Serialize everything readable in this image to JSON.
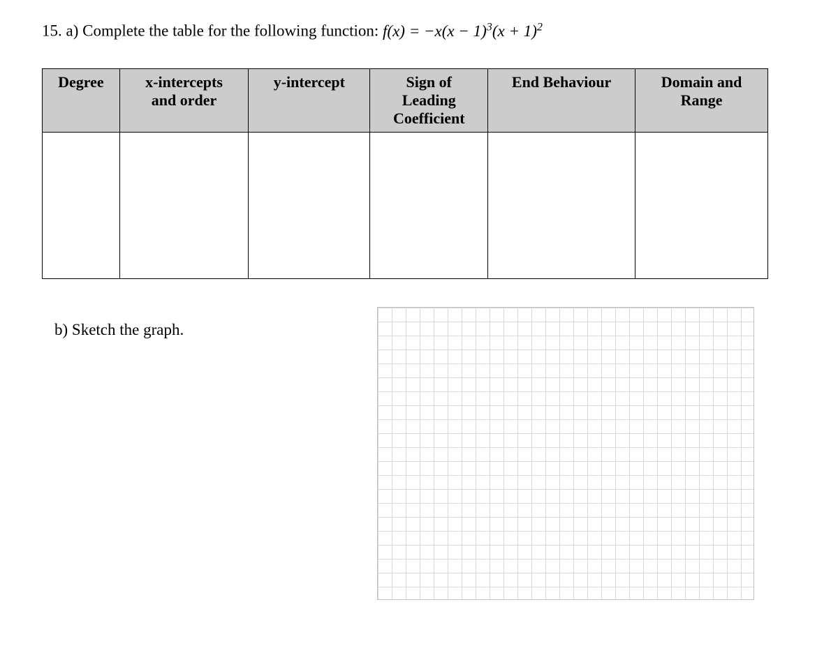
{
  "question": {
    "part_a_prefix": "15. a) Complete the table for the following function: ",
    "function_text": "f(x) = −x(x − 1)³(x + 1)²",
    "part_b": "b) Sketch the graph."
  },
  "table": {
    "headers": {
      "degree": "Degree",
      "x_intercepts_line1": "x-intercepts",
      "x_intercepts_line2": "and order",
      "y_intercept": "y-intercept",
      "sign_line1": "Sign of",
      "sign_line2": "Leading",
      "sign_line3": "Coefficient",
      "end_behaviour": "End Behaviour",
      "domain_line1": "Domain and",
      "domain_range_line2": "Range"
    },
    "cells": {
      "degree": "",
      "x_intercepts": "",
      "y_intercept": "",
      "sign": "",
      "end_behaviour": "",
      "domain_range": ""
    }
  },
  "chart_data": {
    "type": "blank-grid",
    "title": "",
    "grid_cols": 27,
    "grid_rows": 21,
    "xlabel": "",
    "ylabel": "",
    "series": []
  }
}
